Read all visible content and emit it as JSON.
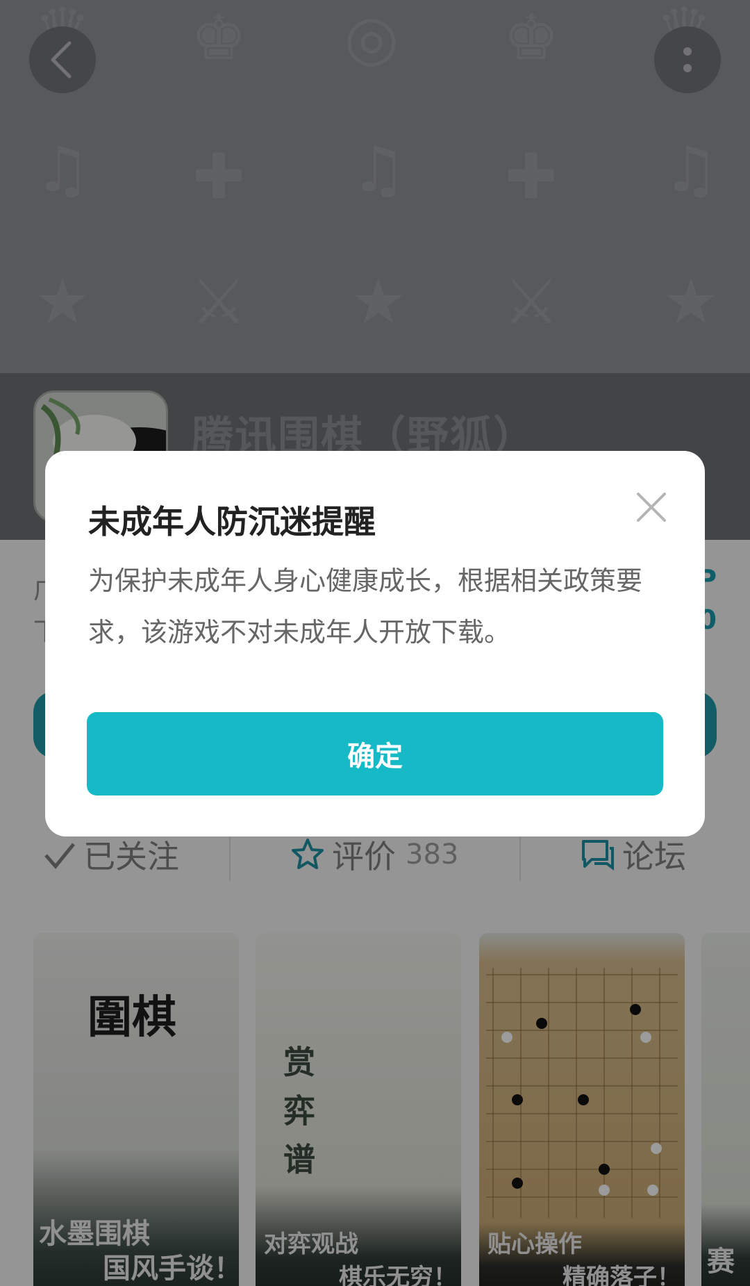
{
  "app": {
    "title": "腾讯围棋（野狐）",
    "info_line_1": "广",
    "info_line_2": "下",
    "side_char_1": "P",
    "side_char_2": "0"
  },
  "actions": {
    "follow_label": "已关注",
    "rate_label": "评价",
    "rate_count": "383",
    "forum_label": "论坛"
  },
  "screenshots": [
    {
      "caption_1": "水墨围棋",
      "caption_2": "国风手谈！"
    },
    {
      "caption_1": "对弈观战",
      "caption_2": "棋乐无穷！"
    },
    {
      "caption_1": "贴心操作",
      "caption_2": "精确落子！"
    },
    {
      "caption_1": "赛"
    }
  ],
  "modal": {
    "title": "未成年人防沉迷提醒",
    "body": "为保护未成年人身心健康成长，根据相关政策要求，该游戏不对未成年人开放下载。",
    "confirm_label": "确定"
  },
  "colors": {
    "accent": "#15bac6",
    "overlay": "rgba(0,0,0,0.38)"
  }
}
